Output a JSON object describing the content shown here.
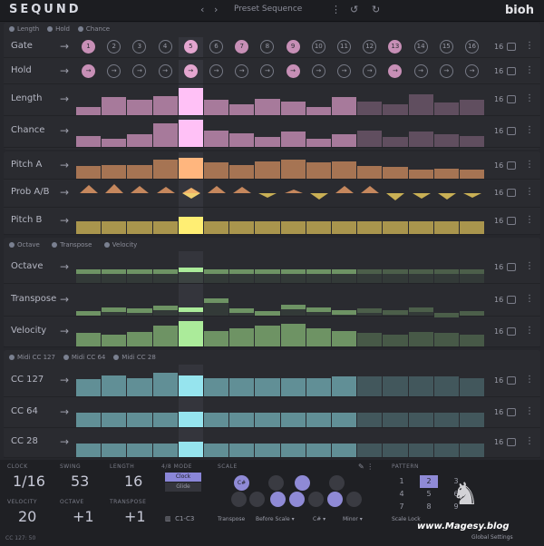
{
  "app": {
    "logo": "SEQUND",
    "preset": "Preset Sequence",
    "brand": "bioh"
  },
  "topicons": {
    "prev": "‹",
    "next": "›",
    "menu": "⋮",
    "undo": "↺",
    "redo": "↻"
  },
  "sections": [
    {
      "options": [
        "Length",
        "Hold",
        "Chance"
      ]
    },
    {
      "options": [
        "Octave",
        "Transpose",
        "Velocity"
      ]
    },
    {
      "options": [
        "Midi CC 127",
        "Midi CC 64",
        "Midi CC 28"
      ]
    }
  ],
  "rows": {
    "gate": {
      "label": "Gate",
      "count": "16",
      "numbers": [
        "1",
        "2",
        "3",
        "4",
        "5",
        "6",
        "7",
        "8",
        "9",
        "10",
        "11",
        "12",
        "13",
        "14",
        "15",
        "16"
      ],
      "active": [
        1,
        0,
        0,
        0,
        1,
        0,
        1,
        0,
        1,
        0,
        0,
        0,
        1,
        0,
        0,
        0
      ]
    },
    "hold": {
      "label": "Hold",
      "count": "16",
      "active": [
        1,
        0,
        0,
        0,
        1,
        0,
        0,
        0,
        1,
        0,
        0,
        0,
        1,
        0,
        0,
        0
      ]
    },
    "length": {
      "label": "Length",
      "count": "16",
      "values": [
        0.3,
        0.65,
        0.55,
        0.7,
        1.0,
        0.55,
        0.4,
        0.6,
        0.5,
        0.3,
        0.65,
        0.5,
        0.4,
        0.75,
        0.45,
        0.55
      ]
    },
    "chance": {
      "label": "Chance",
      "count": "16",
      "values": [
        0.4,
        0.3,
        0.45,
        0.85,
        1.0,
        0.6,
        0.5,
        0.35,
        0.55,
        0.3,
        0.45,
        0.6,
        0.35,
        0.55,
        0.45,
        0.4
      ]
    },
    "pitch_a": {
      "label": "Pitch A",
      "count": "16",
      "values": [
        0.55,
        0.6,
        0.6,
        0.85,
        0.9,
        0.7,
        0.6,
        0.75,
        0.85,
        0.7,
        0.75,
        0.55,
        0.5,
        0.4,
        0.45,
        0.4
      ]
    },
    "prob_ab": {
      "label": "Prob A/B",
      "count": "16",
      "values": [
        0.6,
        0.7,
        0.5,
        0.4,
        0.3,
        0.5,
        0.35,
        -0.2,
        0.1,
        -0.4,
        0.5,
        0.5,
        -0.5,
        -0.3,
        -0.4,
        -0.2
      ]
    },
    "pitch_b": {
      "label": "Pitch B",
      "count": "16",
      "values": [
        0.55,
        0.55,
        0.55,
        0.55,
        0.75,
        0.55,
        0.55,
        0.55,
        0.55,
        0.55,
        0.55,
        0.55,
        0.55,
        0.55,
        0.55,
        0.55
      ]
    },
    "octave": {
      "label": "Octave",
      "count": "16",
      "values": [
        0.5,
        0.5,
        0.5,
        0.5,
        0.55,
        0.5,
        0.5,
        0.5,
        0.5,
        0.5,
        0.5,
        0.5,
        0.5,
        0.5,
        0.5,
        0.5
      ]
    },
    "transpose": {
      "label": "Transpose",
      "count": "16",
      "values": [
        0.15,
        0.3,
        0.25,
        0.35,
        0.3,
        0.6,
        0.25,
        0.15,
        0.4,
        0.3,
        0.2,
        0.25,
        0.2,
        0.3,
        0.1,
        0.15
      ]
    },
    "velocity": {
      "label": "Velocity",
      "count": "16",
      "values": [
        0.5,
        0.45,
        0.55,
        0.8,
        0.95,
        0.6,
        0.7,
        0.8,
        0.85,
        0.7,
        0.6,
        0.5,
        0.45,
        0.55,
        0.5,
        0.45
      ]
    },
    "cc127": {
      "label": "CC 127",
      "count": "16",
      "values": [
        0.6,
        0.75,
        0.65,
        0.85,
        0.75,
        0.65,
        0.65,
        0.65,
        0.65,
        0.65,
        0.7,
        0.7,
        0.7,
        0.7,
        0.7,
        0.65
      ]
    },
    "cc64": {
      "label": "CC 64",
      "count": "16",
      "values": [
        0.55,
        0.55,
        0.55,
        0.55,
        0.6,
        0.55,
        0.55,
        0.55,
        0.55,
        0.55,
        0.55,
        0.55,
        0.55,
        0.55,
        0.55,
        0.55
      ]
    },
    "cc28": {
      "label": "CC 28",
      "count": "16",
      "values": [
        0.55,
        0.55,
        0.55,
        0.55,
        0.6,
        0.55,
        0.55,
        0.55,
        0.55,
        0.55,
        0.55,
        0.55,
        0.55,
        0.55,
        0.55,
        0.55
      ]
    }
  },
  "bottom": {
    "clock_label": "CLOCK",
    "clock_value": "1/16",
    "swing_label": "SWING",
    "swing_value": "53",
    "length_label": "LENGTH",
    "length_value": "16",
    "velocity_label": "VELOCITY",
    "velocity_value": "20",
    "octave_label": "OCTAVE",
    "octave_value": "+1",
    "transpose_label": "TRANSPOSE",
    "transpose_value": "+1",
    "gate_mode_label": "4/8 MODE",
    "clock_btn": "Clock",
    "glide_btn": "Glide",
    "range": "C1-C3",
    "scale_label": "SCALE",
    "transpose_sel_label": "Transpose",
    "transpose_sel": "Before Scale",
    "key_sel": "C#",
    "mode_sel": "Minor",
    "root_note": "C#",
    "pattern_label": "PATTERN",
    "patterns": [
      "1",
      "2",
      "3",
      "4",
      "5",
      "6",
      "7",
      "8",
      "9"
    ],
    "scale_lock": "Scale Lock",
    "status": "CC 127: 50",
    "watermark": "www.Magesy.blog",
    "global_settings": "Global Settings"
  },
  "colors": {
    "pink": "#c78fb6",
    "orange": "#c5875d",
    "yellow": "#c9b055",
    "green": "#7fae72",
    "teal": "#6fa9b0"
  }
}
